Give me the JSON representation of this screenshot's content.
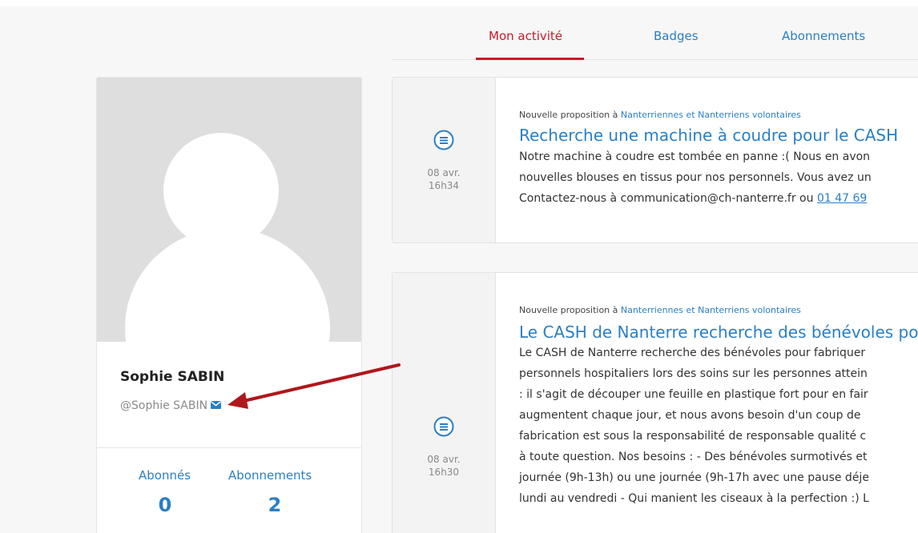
{
  "tabs": [
    {
      "label": "Mon activité",
      "active": true
    },
    {
      "label": "Badges",
      "active": false
    },
    {
      "label": "Abonnements",
      "active": false
    }
  ],
  "profile": {
    "name": "Sophie SABIN",
    "handle": "@Sophie SABIN",
    "followers_label": "Abonnés",
    "followers_count": "0",
    "following_label": "Abonnements",
    "following_count": "2"
  },
  "activities": [
    {
      "icon": "message-icon",
      "date": "08 avr.",
      "time": "16h34",
      "meta_prefix": "Nouvelle proposition à ",
      "meta_link": "Nanterriennes et Nanterriens volontaires",
      "title": "Recherche une machine à coudre pour le CASH",
      "lines": [
        "Notre machine à coudre est tombée en panne :( Nous en avon",
        "nouvelles blouses en tissus pour nos personnels. Vous avez un",
        "Contactez-nous à communication@ch-nanterre.fr ou "
      ],
      "phone": "01 47 69"
    },
    {
      "icon": "message-icon",
      "date": "08 avr.",
      "time": "16h30",
      "meta_prefix": "Nouvelle proposition à ",
      "meta_link": "Nanterriennes et Nanterriens volontaires",
      "title": "Le CASH de Nanterre recherche des bénévoles po",
      "lines": [
        "Le CASH de Nanterre recherche des bénévoles pour fabriquer",
        "personnels hospitaliers lors des soins sur les personnes attein",
        ": il s'agit de découper une feuille en plastique fort pour en fair",
        "augmentent chaque jour, et nous avons besoin d'un coup de",
        "fabrication est sous la responsabilité de responsable qualité c",
        "à toute question. Nos besoins : - Des bénévoles surmotivés et",
        "journée (9h-13h) ou une journée (9h-17h avec une pause déje",
        "lundi au vendredi - Qui manient les ciseaux à la perfection :) L"
      ]
    }
  ],
  "colors": {
    "accent_red": "#c8192a",
    "link_blue": "#2a7fc4",
    "annotation_arrow": "#b0171c"
  }
}
